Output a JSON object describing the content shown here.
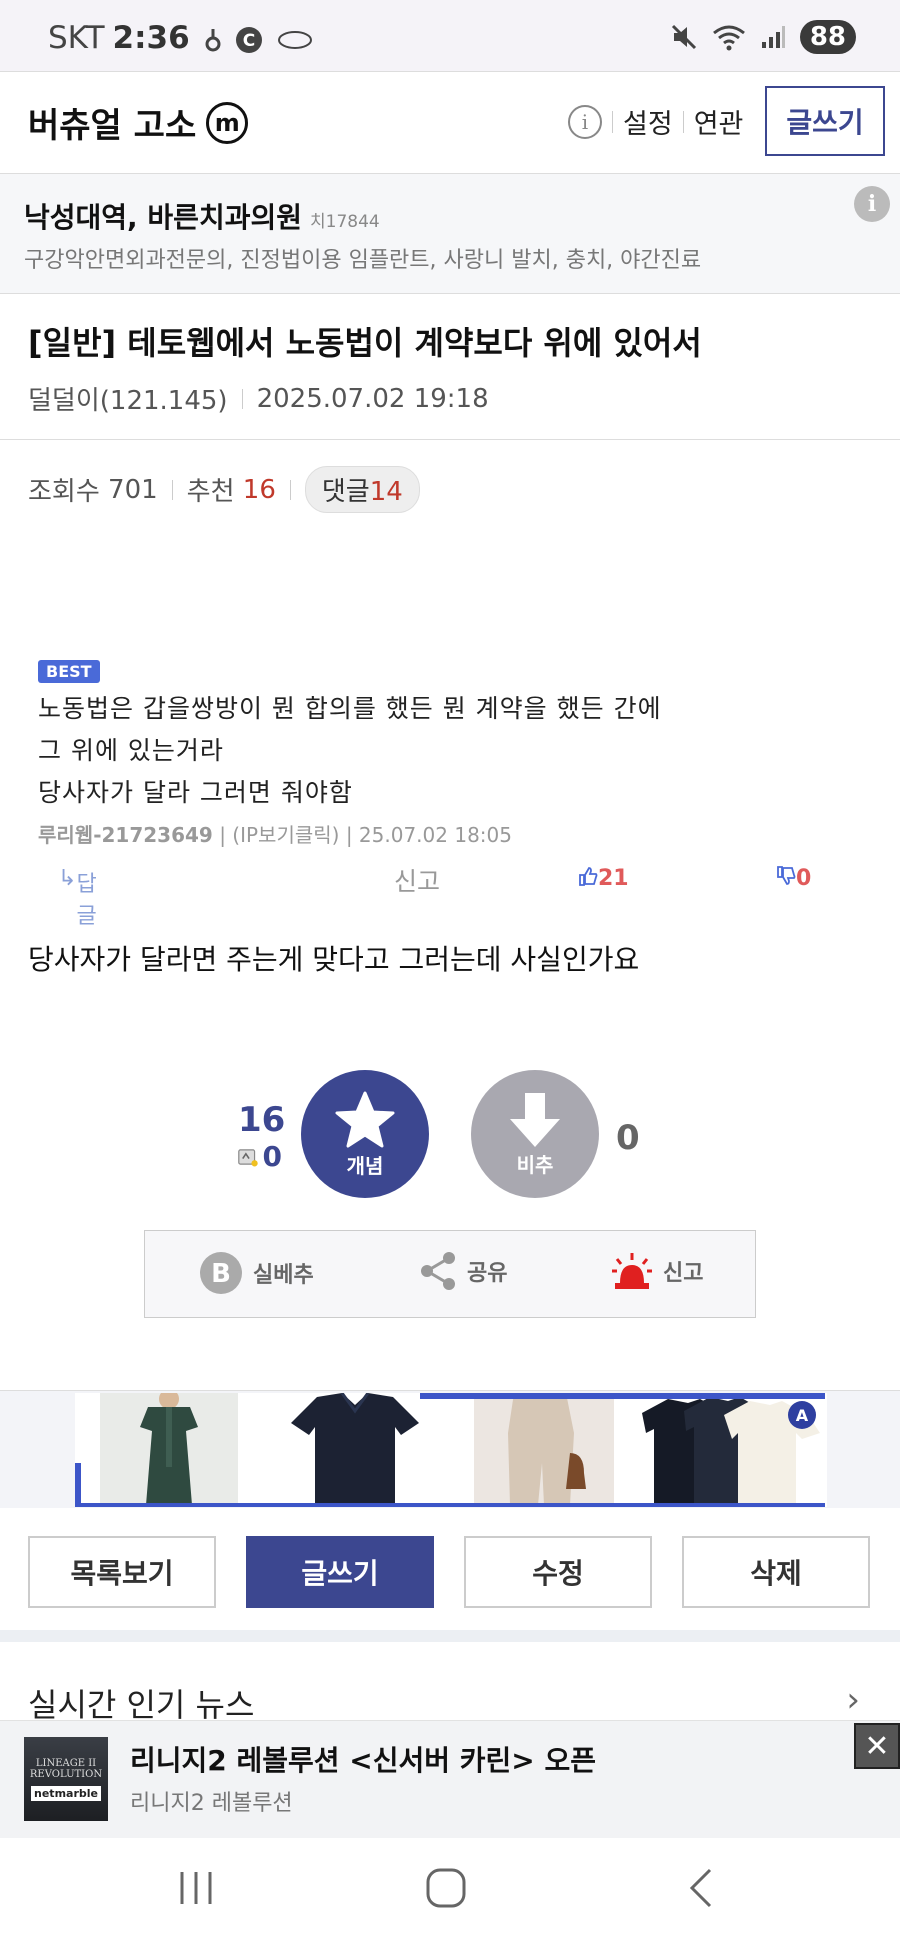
{
  "status_bar": {
    "carrier": "SKT",
    "time": "2:36",
    "battery": "88"
  },
  "header": {
    "board_title": "버츄얼 고소",
    "board_badge": "m",
    "links": [
      "설정",
      "연관"
    ],
    "write_label": "글쓰기"
  },
  "clinic_ad": {
    "name": "낙성대역, 바른치과의원",
    "code": "치17844",
    "desc": "구강악안면외과전문의, 진정법이용 임플란트, 사랑니 발치, 충치, 야간진료"
  },
  "post": {
    "title": "[일반] 테토웹에서 노동법이 계약보다 위에 있어서",
    "author": "덜덜이(121.145)",
    "date": "2025.07.02 19:18",
    "views_label": "조회수",
    "views": "701",
    "recommend_label": "추천",
    "recommend": "16",
    "comments_label": "댓글",
    "comments": "14",
    "body": "당사자가 달라면 주는게 맞다고 그러는데 사실인가요"
  },
  "embedded_comment": {
    "badge": "BEST",
    "lines": [
      "노동법은 갑을쌍방이 뭔 합의를 했든 뭔 계약을 했든 간에",
      "그 위에 있는거라",
      "당사자가 달라 그러면 줘야함"
    ],
    "author": "루리웹-21723649",
    "ip_label": "(IP보기클릭)",
    "date": "25.07.02 18:05",
    "reply_label": "답글",
    "report_label": "신고",
    "likes": "21",
    "dislikes": "0"
  },
  "vote": {
    "up_count": "16",
    "fixed_count": "0",
    "up_label": "개념",
    "down_label": "비추",
    "down_count": "0"
  },
  "share_box": {
    "best_label": "실베추",
    "share_label": "공유",
    "report_label": "신고"
  },
  "shop_banner": {
    "badge": "A"
  },
  "actions": {
    "list_label": "목록보기",
    "write_label": "글쓰기",
    "edit_label": "수정",
    "delete_label": "삭제"
  },
  "news": {
    "title": "실시간 인기 뉴스"
  },
  "bottom_ad": {
    "logo_line": "LINEAGE II",
    "logo_sub": "REVOLUTION",
    "logo_brand": "netmarble",
    "title": "리니지2 레볼루션 <신서버 카린> 오픈",
    "subtitle": "리니지2 레볼루션"
  },
  "colors": {
    "accent": "#3c4790",
    "highlight_red": "#c0392b",
    "like_blue": "#4a6ad8"
  }
}
